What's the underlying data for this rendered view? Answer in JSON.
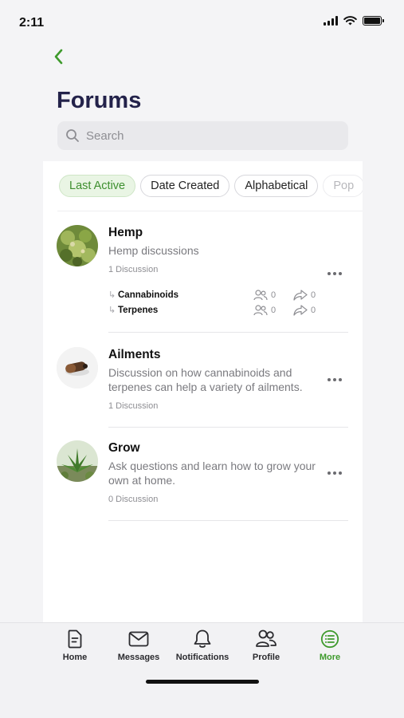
{
  "status": {
    "time": "2:11"
  },
  "header": {
    "title": "Forums"
  },
  "search": {
    "placeholder": "Search"
  },
  "filters": [
    "Last Active",
    "Date Created",
    "Alphabetical",
    "Pop"
  ],
  "forums": [
    {
      "name": "Hemp",
      "description": "Hemp discussions",
      "count": "1 Discussion",
      "subforums": [
        {
          "name": "Cannabinoids",
          "members": "0",
          "shares": "0"
        },
        {
          "name": "Terpenes",
          "members": "0",
          "shares": "0"
        }
      ]
    },
    {
      "name": "Ailments",
      "description": "Discussion on how cannabinoids and terpenes can help a variety of ailments.",
      "count": "1 Discussion"
    },
    {
      "name": "Grow",
      "description": "Ask questions and learn how to grow your own at home.",
      "count": "0 Discussion"
    }
  ],
  "tabbar": {
    "items": [
      {
        "label": "Home",
        "icon": "document-icon"
      },
      {
        "label": "Messages",
        "icon": "envelope-icon"
      },
      {
        "label": "Notifications",
        "icon": "bell-icon"
      },
      {
        "label": "Profile",
        "icon": "users-icon"
      },
      {
        "label": "More",
        "icon": "list-circle-icon"
      }
    ],
    "active": "More"
  },
  "colors": {
    "accent": "#3e9a2c",
    "title": "#23224a",
    "chip_active_bg": "#e9f5e4"
  }
}
